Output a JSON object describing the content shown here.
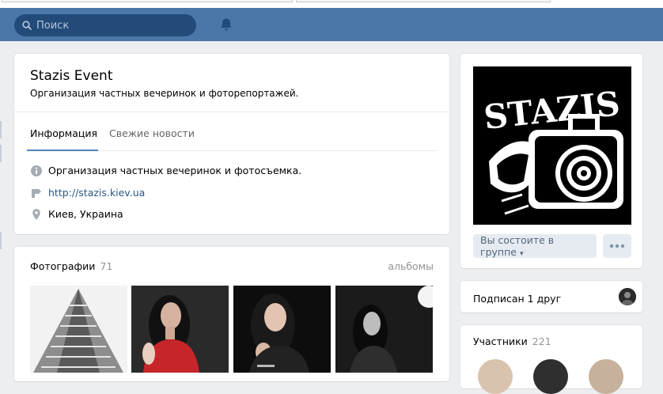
{
  "search": {
    "placeholder": "Поиск"
  },
  "group": {
    "name": "Stazis Event",
    "status": "Организация частных вечеринок и фоторепортажей.",
    "tabs": [
      {
        "label": "Информация"
      },
      {
        "label": "Свежие новости"
      }
    ],
    "info": {
      "description": "Организация частных вечеринок и фотосъемка.",
      "website": "http://stazis.kiev.ua",
      "location": "Киев, Украина"
    }
  },
  "photos": {
    "title": "Фотографии",
    "count": "71",
    "albums_link": "альбомы"
  },
  "sidebar": {
    "logo_text": "STAZIS",
    "member_button": "Вы состоите в группе",
    "friends_text": "Подписан 1 друг",
    "members_title": "Участники",
    "members_count": "221"
  },
  "colors": {
    "header": "#4a76a8",
    "search_bg": "#224b7a",
    "link": "#2a5885",
    "accent": "#5181b8",
    "page_bg": "#edeef0"
  },
  "icons": {
    "search": "search-icon",
    "bell": "bell-icon",
    "info": "info-icon",
    "link": "link-arrow-icon",
    "location": "location-pin-icon",
    "more": "more-dots-icon",
    "chevron": "chevron-down-icon"
  }
}
